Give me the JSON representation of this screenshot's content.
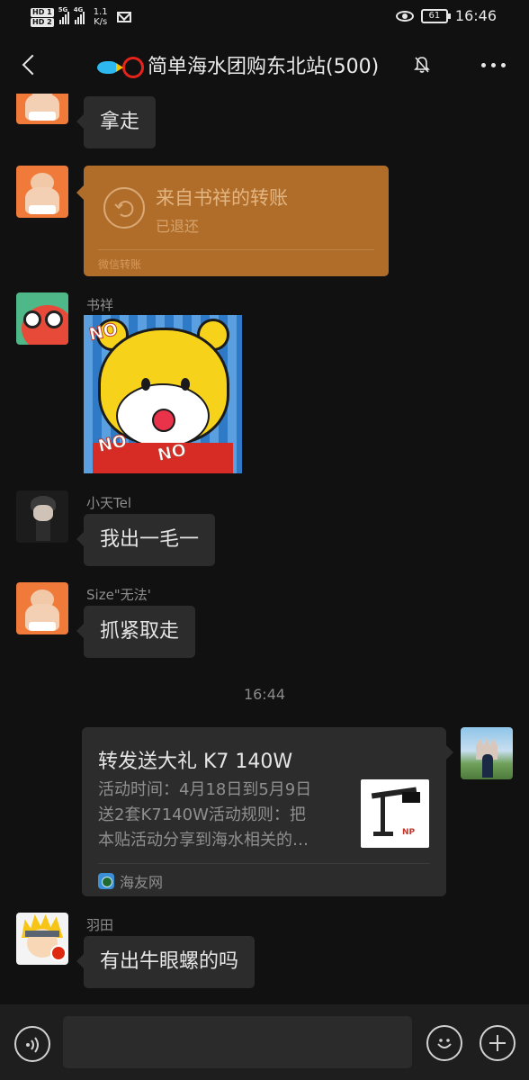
{
  "status_bar": {
    "hd1": "HD 1",
    "hd2": "HD 2",
    "net1": "5G",
    "net2": "4G",
    "speed_value": "1.1",
    "speed_unit": "K/s",
    "battery": "61",
    "time": "16:46"
  },
  "header": {
    "title": "简单海水团购东北站(500)",
    "icons": [
      "back-icon",
      "fish-emoji-icon",
      "red-ring-emoji-icon",
      "muted-bell-icon",
      "more-icon"
    ]
  },
  "messages": {
    "m1": {
      "text": "拿走"
    },
    "m2": {
      "title": "来自书祥的转账",
      "status": "已退还",
      "footer": "微信转账"
    },
    "m3": {
      "sender": "书祥",
      "sticker_text_1": "NO",
      "sticker_text_2": "NO",
      "sticker_text_3": "NO"
    },
    "m4": {
      "sender": "小天Tel",
      "text": "我出一毛一"
    },
    "m5": {
      "sender": "Size\"无法'",
      "text": "抓紧取走"
    },
    "timestamp": "16:44",
    "m6": {
      "title": "转发送大礼 K7 140W",
      "desc_line1": "活动时间：4月18日到5月9日",
      "desc_line2": "送2套K7140W活动规则：把",
      "desc_line3": "本贴活动分享到海水相关的…",
      "thumb_text": "NP",
      "source": "海友网"
    },
    "m7": {
      "sender": "羽田",
      "text": "有出牛眼螺的吗"
    }
  },
  "input_bar": {
    "placeholder": "",
    "icons": [
      "voice-icon",
      "emoji-icon",
      "plus-icon"
    ]
  },
  "colors": {
    "background": "#111111",
    "bubble": "#2c2c2c",
    "transfer_card": "#b06d2a",
    "text_primary": "#e6e6e6",
    "text_secondary": "#8d8d8d"
  }
}
